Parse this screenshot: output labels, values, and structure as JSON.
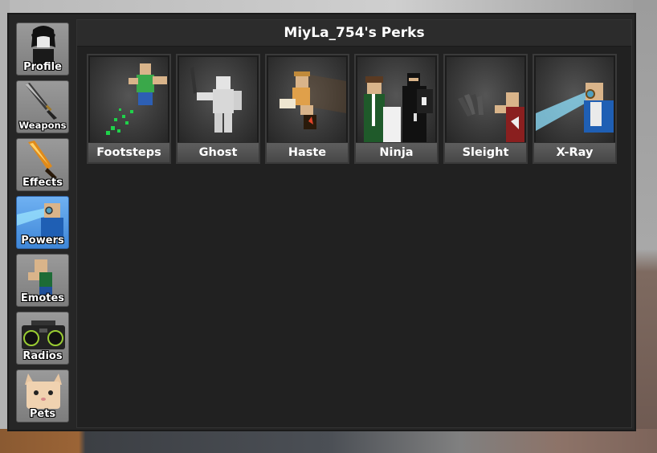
{
  "window": {
    "title": "MiyLa_754's Perks"
  },
  "sidebar": {
    "items": [
      {
        "label": "Profile",
        "icon": "avatar-icon",
        "active": false
      },
      {
        "label": "Weapons",
        "icon": "knife-icon",
        "active": false
      },
      {
        "label": "Effects",
        "icon": "flame-knife-icon",
        "active": false
      },
      {
        "label": "Powers",
        "icon": "xray-character-icon",
        "active": true
      },
      {
        "label": "Emotes",
        "icon": "emote-character-icon",
        "active": false
      },
      {
        "label": "Radios",
        "icon": "boombox-icon",
        "active": false
      },
      {
        "label": "Pets",
        "icon": "cat-icon",
        "active": false
      }
    ]
  },
  "perks": [
    {
      "label": "Footsteps",
      "icon": "footsteps-icon"
    },
    {
      "label": "Ghost",
      "icon": "ghost-icon"
    },
    {
      "label": "Haste",
      "icon": "haste-icon"
    },
    {
      "label": "Ninja",
      "icon": "ninja-icon"
    },
    {
      "label": "Sleight",
      "icon": "sleight-icon"
    },
    {
      "label": "X-Ray",
      "icon": "xray-icon"
    }
  ],
  "colors": {
    "active_tab": "#4a90e2",
    "panel": "#212121",
    "label_bar": "#555555"
  }
}
